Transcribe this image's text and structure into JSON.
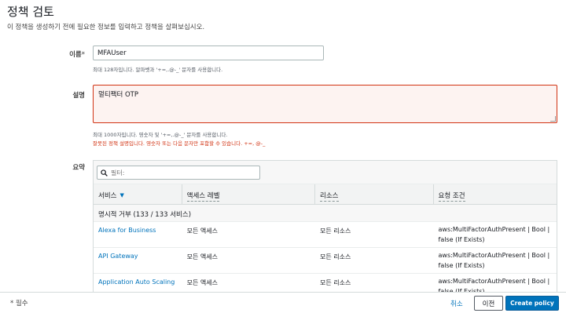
{
  "page": {
    "title": "정책 검토",
    "subtitle": "이 정책을 생성하기 전에 필요한 정보를 입력하고 정책을 살펴보십시오."
  },
  "name_field": {
    "label": "이름",
    "required_mark": "*",
    "value": "MFAUser",
    "hint": "최대 128자입니다. 알파벳과 '+=,.@-_' 문자를 사용합니다."
  },
  "description_field": {
    "label": "설명",
    "value": "멀티팩터 OTP",
    "hint": "최대 1000자입니다. 영숫자 및 '+=,.@-_' 문자를 사용합니다.",
    "error": "잘못된 정책 설명입니다. 영숫자 또는 다음 문자만 포함할 수 있습니다. +=, @-_"
  },
  "summary": {
    "label": "요약",
    "filter_placeholder": "필터:",
    "columns": [
      "서비스",
      "액세스 레벨",
      "리소스",
      "요청 조건"
    ],
    "group_label": "명시적 거부 (133 / 133 서비스)",
    "rows": [
      {
        "service": "Alexa for Business",
        "access": "모든 액세스",
        "resource": "모든 리소스",
        "condition": "aws:MultiFactorAuthPresent | Bool | false (If Exists)"
      },
      {
        "service": "API Gateway",
        "access": "모든 액세스",
        "resource": "모든 리소스",
        "condition": "aws:MultiFactorAuthPresent | Bool | false (If Exists)"
      },
      {
        "service": "Application Auto Scaling",
        "access": "모든 액세스",
        "resource": "모든 리소스",
        "condition": "aws:MultiFactorAuthPresent | Bool | false (If Exists)"
      }
    ]
  },
  "footer": {
    "required_note": "* 필수",
    "cancel_label": "취소",
    "previous_label": "이전",
    "create_label": "Create policy"
  },
  "colors": {
    "link": "#0073bb",
    "error": "#d13212",
    "primary_button": "#0073bb"
  }
}
